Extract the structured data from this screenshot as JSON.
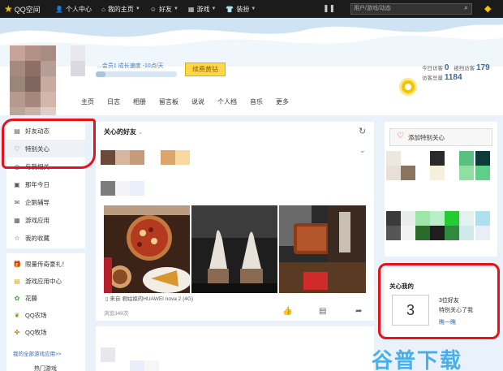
{
  "topbar": {
    "logo_text": "QQ空间",
    "nav": [
      {
        "icon": "user-icon",
        "glyph": "👤",
        "label": "个人中心",
        "caret": false
      },
      {
        "icon": "home-icon",
        "glyph": "⌂",
        "label": "我的主页",
        "caret": true
      },
      {
        "icon": "friends-icon",
        "glyph": "☺",
        "label": "好友",
        "caret": true
      },
      {
        "icon": "games-icon",
        "glyph": "▦",
        "label": "游戏",
        "caret": true
      },
      {
        "icon": "dressup-icon",
        "glyph": "👕",
        "label": "装扮",
        "caret": true
      }
    ],
    "search_placeholder": "用户/游戏/动态"
  },
  "header": {
    "level_text": "...会员1  成长速度 -10点/天",
    "progress_fraction": 0.12,
    "renew_label": "续费黄钻",
    "tabs": [
      "主页",
      "日志",
      "相册",
      "留言板",
      "说说",
      "个人档",
      "音乐",
      "更多"
    ],
    "visits": {
      "today_label": "今日访客",
      "today_value": "0",
      "blocked_label": "被挡访客",
      "blocked_value": "179",
      "total_label": "访客总量",
      "total_value": "1184"
    }
  },
  "sidebar": {
    "items": [
      {
        "icon": "feed-icon",
        "glyph": "▤",
        "label": "好友动态",
        "active": false
      },
      {
        "icon": "heart-icon",
        "glyph": "♡",
        "label": "特别关心",
        "active": true
      },
      {
        "icon": "mention-icon",
        "glyph": "◎",
        "label": "与我相关",
        "active": false
      },
      {
        "icon": "calendar-icon",
        "glyph": "▣",
        "label": "那年今日",
        "active": false
      },
      {
        "icon": "tutoring-icon",
        "glyph": "✉",
        "label": "企鹅辅导",
        "active": false
      },
      {
        "icon": "apps-icon",
        "glyph": "▦",
        "label": "游戏应用",
        "active": false
      },
      {
        "icon": "favorites-icon",
        "glyph": "☆",
        "label": "我的收藏",
        "active": false
      }
    ],
    "apps": [
      {
        "icon": "gift-icon",
        "glyph": "🎁",
        "label": "限量传奇豪礼！"
      },
      {
        "icon": "game-center-icon",
        "glyph": "▤",
        "label": "游戏应用中心"
      },
      {
        "icon": "flower-icon",
        "glyph": "✿",
        "label": "花藤"
      },
      {
        "icon": "farm-icon",
        "glyph": "❦",
        "label": "QQ农场"
      },
      {
        "icon": "ranch-icon",
        "glyph": "✤",
        "label": "QQ牧场"
      }
    ],
    "all_apps_link": "我的全部游戏应用>>",
    "hot_games": "热门游戏"
  },
  "feed": {
    "title": "关心的好友",
    "source_text": "来自 君姑娘的HUAWEI nova 2 (4G)",
    "views_text": "浏览349次"
  },
  "right": {
    "add_special_label": "添加特别关心",
    "care_title": "关心我的",
    "calendar_number": "3",
    "birthday_count": "3位好友",
    "birthday_text": "特别关心了我",
    "birthday_link": "瞧一瞧"
  },
  "watermark": "谷普下载",
  "colors": {
    "topbar": "#1b1b1b",
    "accent_yellow": "#ffd84a",
    "annotation_red": "#e8111a",
    "link_blue": "#3a6ab0"
  }
}
